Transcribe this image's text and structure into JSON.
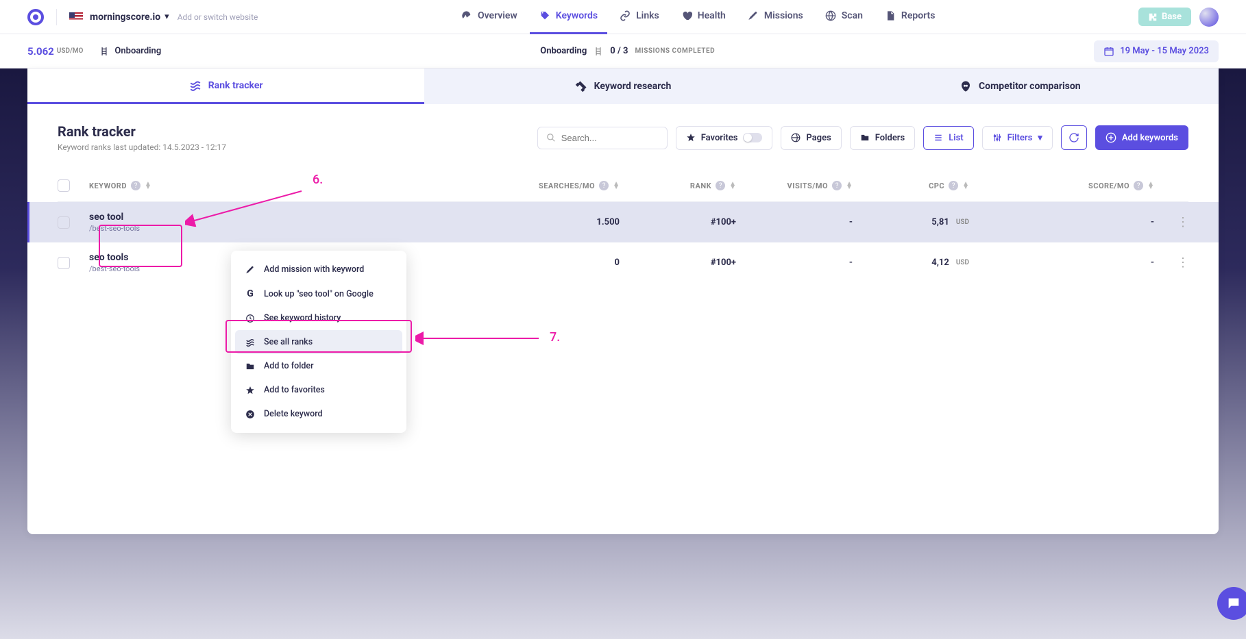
{
  "header": {
    "site_name": "morningscore.io",
    "add_site": "Add or switch website",
    "nav": [
      {
        "label": "Overview"
      },
      {
        "label": "Keywords"
      },
      {
        "label": "Links"
      },
      {
        "label": "Health"
      },
      {
        "label": "Missions"
      },
      {
        "label": "Scan"
      },
      {
        "label": "Reports"
      }
    ],
    "base_label": "Base"
  },
  "subbar": {
    "score": "5.062",
    "score_unit": "USD/MO",
    "onboarding": "Onboarding",
    "center_label": "Onboarding",
    "progress_done": "0",
    "progress_sep": "/",
    "progress_total": "3",
    "progress_label": "MISSIONS COMPLETED",
    "date_range": "19 May - 15 May 2023"
  },
  "tabs": [
    {
      "label": "Rank tracker"
    },
    {
      "label": "Keyword research"
    },
    {
      "label": "Competitor comparison"
    }
  ],
  "toolbar": {
    "title": "Rank tracker",
    "subtitle": "Keyword ranks last updated: 14.5.2023 - 12:17",
    "search_placeholder": "Search...",
    "favorites": "Favorites",
    "pages": "Pages",
    "folders": "Folders",
    "list": "List",
    "filters": "Filters",
    "add_keywords": "Add keywords"
  },
  "columns": {
    "keyword": "KEYWORD",
    "searches": "SEARCHES/MO",
    "rank": "RANK",
    "visits": "VISITS/MO",
    "cpc": "CPC",
    "score": "SCORE/MO"
  },
  "rows": [
    {
      "keyword": "seo tool",
      "url": "/best-seo-tools",
      "searches": "1.500",
      "rank": "#100+",
      "visits": "-",
      "cpc": "5,81",
      "cpc_unit": "USD",
      "score": "-"
    },
    {
      "keyword": "seo tools",
      "url": "/best-seo-tools",
      "searches": "0",
      "rank": "#100+",
      "visits": "-",
      "cpc": "4,12",
      "cpc_unit": "USD",
      "score": "-"
    }
  ],
  "ctx_menu": [
    {
      "label": "Add mission with keyword"
    },
    {
      "label": "Look up \"seo tool\" on Google"
    },
    {
      "label": "See keyword history"
    },
    {
      "label": "See all ranks"
    },
    {
      "label": "Add to folder"
    },
    {
      "label": "Add to favorites"
    },
    {
      "label": "Delete keyword"
    }
  ],
  "annotations": {
    "a6": "6.",
    "a7": "7."
  }
}
